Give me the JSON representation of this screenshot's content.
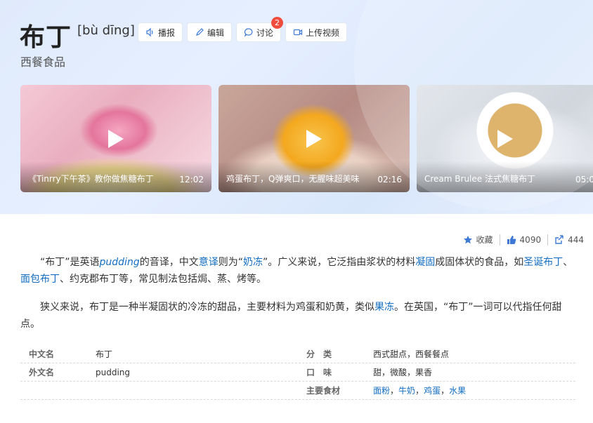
{
  "header": {
    "title": "布丁",
    "pinyin": "[bù dīng]",
    "subtitle": "西餐食品",
    "buttons": {
      "broadcast": "播报",
      "edit": "编辑",
      "discuss": "讨论",
      "discuss_badge": "2",
      "upload_video": "上传视频"
    }
  },
  "videos": [
    {
      "caption": "《Tinrry下午茶》教你做焦糖布丁",
      "duration": "12:02"
    },
    {
      "caption": "鸡蛋布丁，Q弹爽口，无腥味超美味",
      "duration": "02:16"
    },
    {
      "caption": "Cream Brulee 法式焦糖布丁",
      "duration": "05:0"
    }
  ],
  "actions": {
    "favorite": "收藏",
    "likes": "4090",
    "shares": "444"
  },
  "paragraph1": {
    "t1": "“布丁”是英语",
    "l1": "pudding",
    "t2": "的音译，中文",
    "l2": "意译",
    "t3": "则为“",
    "l3": "奶冻",
    "t4": "”。广义来说，它泛指由浆状的材料",
    "l4": "凝固",
    "t5": "成固体状的食品，如",
    "l5": "圣诞布丁",
    "t6": "、",
    "l6": "面包布丁",
    "t7": "、约克郡布丁等，常见制法包括焗、蒸、烤等。"
  },
  "paragraph2": {
    "t1": "狭义来说，布丁是一种半凝固状的冷冻的甜品，主要材料为鸡蛋和奶黄，类似",
    "l1": "果冻",
    "t2": "。在英国，“布丁”一词可以代指任何甜点。"
  },
  "infobox": {
    "rows": [
      {
        "k1": "中文名",
        "v1": "布丁",
        "k2": "分　类",
        "v2": "西式甜点，西餐餐点"
      },
      {
        "k1": "外文名",
        "v1": "pudding",
        "k2": "口　味",
        "v2": "甜，微酸，果香"
      }
    ],
    "ingredients_label": "主要食材",
    "ingredients": [
      "面粉",
      "牛奶",
      "鸡蛋",
      "水果"
    ],
    "ingredients_sep": "，"
  },
  "colors": {
    "link": "#136ec2",
    "badge": "#f04d3f",
    "hero_bg": "#dfeafb"
  }
}
